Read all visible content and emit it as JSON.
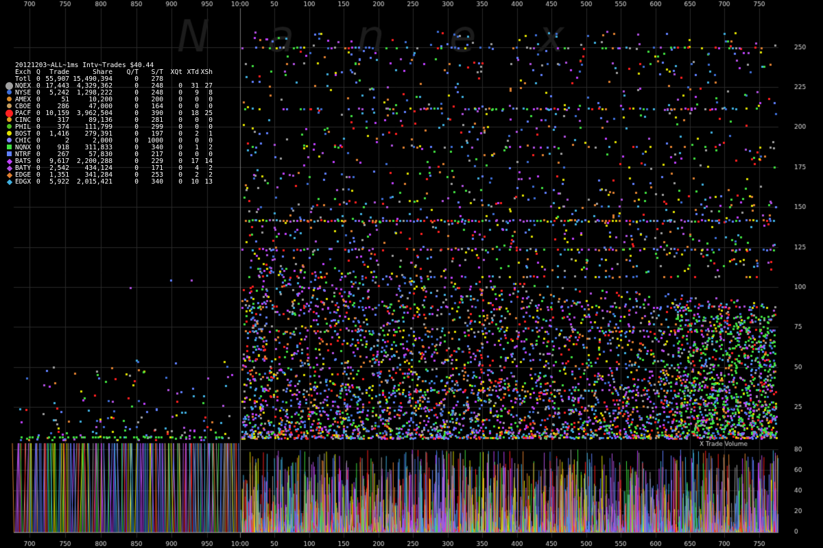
{
  "header": {
    "title": "20121203~ALL~1ms Intv~Trades $40.44",
    "watermark": [
      "N",
      "a",
      "n",
      "e",
      "x"
    ]
  },
  "table": {
    "columns": [
      "Exch",
      "Q",
      "Trade",
      "Share",
      "Q/T",
      "S/T",
      "XQt",
      "XTd",
      "XSh"
    ],
    "rows": [
      {
        "exch": "Totl",
        "q": "0",
        "trade": "55,907",
        "share": "15,490,394",
        "qt": "0",
        "st": "278",
        "xqt": "",
        "xtd": "",
        "xsh": "",
        "color": "",
        "marker": "none"
      },
      {
        "exch": "NQEX",
        "q": "0",
        "trade": "17,443",
        "share": "4,329,362",
        "qt": "0",
        "st": "248",
        "xqt": "0",
        "xtd": "31",
        "xsh": "27",
        "color": "#a0a0a0",
        "marker": "big-circle"
      },
      {
        "exch": "NYSE",
        "q": "0",
        "trade": "5,242",
        "share": "1,298,222",
        "qt": "0",
        "st": "248",
        "xqt": "0",
        "xtd": "9",
        "xsh": "8",
        "color": "#3f6fd8",
        "marker": "circle"
      },
      {
        "exch": "AMEX",
        "q": "0",
        "trade": "51",
        "share": "10,200",
        "qt": "0",
        "st": "200",
        "xqt": "0",
        "xtd": "0",
        "xsh": "0",
        "color": "#d88a2a",
        "marker": "circle"
      },
      {
        "exch": "CBOE",
        "q": "0",
        "trade": "286",
        "share": "47,000",
        "qt": "0",
        "st": "164",
        "xqt": "0",
        "xtd": "0",
        "xsh": "0",
        "color": "#c8a060",
        "marker": "circle"
      },
      {
        "exch": "PACF",
        "q": "0",
        "trade": "10,159",
        "share": "3,962,504",
        "qt": "0",
        "st": "390",
        "xqt": "0",
        "xtd": "18",
        "xsh": "25",
        "color": "#ff2020",
        "marker": "big-circle"
      },
      {
        "exch": "CINC",
        "q": "0",
        "trade": "317",
        "share": "89,136",
        "qt": "0",
        "st": "281",
        "xqt": "0",
        "xtd": "0",
        "xsh": "0",
        "color": "#e0a020",
        "marker": "circle"
      },
      {
        "exch": "PHIL",
        "q": "0",
        "trade": "374",
        "share": "111,799",
        "qt": "0",
        "st": "299",
        "xqt": "0",
        "xtd": "0",
        "xsh": "0",
        "color": "#50c020",
        "marker": "circle"
      },
      {
        "exch": "BOST",
        "q": "0",
        "trade": "1,416",
        "share": "279,391",
        "qt": "0",
        "st": "197",
        "xqt": "0",
        "xtd": "2",
        "xsh": "1",
        "color": "#e0e000",
        "marker": "circle"
      },
      {
        "exch": "CHIC",
        "q": "0",
        "trade": "2",
        "share": "2,000",
        "qt": "0",
        "st": "1000",
        "xqt": "0",
        "xtd": "0",
        "xsh": "0",
        "color": "#8080ff",
        "marker": "circle"
      },
      {
        "exch": "NQNX",
        "q": "0",
        "trade": "918",
        "share": "311,833",
        "qt": "0",
        "st": "340",
        "xqt": "0",
        "xtd": "1",
        "xsh": "2",
        "color": "#40e040",
        "marker": "square"
      },
      {
        "exch": "NTRF",
        "q": "0",
        "trade": "267",
        "share": "57,830",
        "qt": "0",
        "st": "217",
        "xqt": "0",
        "xtd": "0",
        "xsh": "0",
        "color": "#6080ff",
        "marker": "square"
      },
      {
        "exch": "BATS",
        "q": "0",
        "trade": "9,617",
        "share": "2,200,288",
        "qt": "0",
        "st": "229",
        "xqt": "0",
        "xtd": "17",
        "xsh": "14",
        "color": "#c040ff",
        "marker": "diamond"
      },
      {
        "exch": "BATY",
        "q": "0",
        "trade": "2,542",
        "share": "434,124",
        "qt": "0",
        "st": "171",
        "xqt": "0",
        "xtd": "4",
        "xsh": "2",
        "color": "#b050e0",
        "marker": "diamond"
      },
      {
        "exch": "EDGE",
        "q": "0",
        "trade": "1,351",
        "share": "341,284",
        "qt": "0",
        "st": "253",
        "xqt": "0",
        "xtd": "2",
        "xsh": "2",
        "color": "#e08030",
        "marker": "diamond"
      },
      {
        "exch": "EDGX",
        "q": "0",
        "trade": "5,922",
        "share": "2,015,421",
        "qt": "0",
        "st": "340",
        "xqt": "0",
        "xtd": "10",
        "xsh": "13",
        "color": "#40b0e0",
        "marker": "diamond"
      }
    ]
  },
  "chart_data": [
    {
      "type": "scatter",
      "title": "20121203~ALL~1ms Intv~Trades $40.44",
      "xlabel": "",
      "ylabel": "",
      "x_tick_labels": [
        "700",
        "750",
        "800",
        "850",
        "900",
        "950",
        "10:00",
        "50",
        "100",
        "150",
        "200",
        "250",
        "300",
        "350",
        "400",
        "450",
        "500",
        "550",
        "600",
        "650",
        "700",
        "750"
      ],
      "y_ticks": [
        25,
        50,
        75,
        100,
        125,
        150,
        175,
        200,
        225,
        250
      ],
      "ylim": [
        0,
        265
      ],
      "series_colors": [
        "#a0a0a0",
        "#ff2020",
        "#c040ff",
        "#40b0e0",
        "#3f6fd8",
        "#40e040",
        "#b050e0",
        "#e08030",
        "#e0e000",
        "#6080ff"
      ],
      "density_profile": {
        "pre_open": "sparse points mostly below 50",
        "post_open": "dense band from about 8 to 110 thinning to the right; horizontal streaks near 142, 124, 107, 88, 73, 36"
      }
    },
    {
      "type": "line",
      "title": "X Trade Volume",
      "y_ticks": [
        0,
        20,
        40,
        60,
        80
      ],
      "ylim": [
        0,
        85
      ],
      "description": "many overlapping colored vertical spikes; saturated to the top before 10:00, spikes 10 to 80 after"
    }
  ]
}
